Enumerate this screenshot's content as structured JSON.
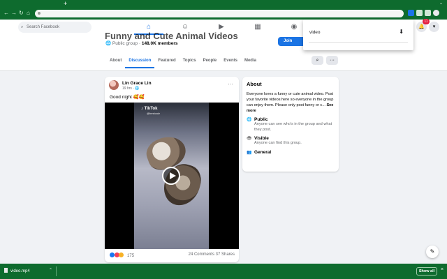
{
  "browser": {
    "newtab_label": "+",
    "tabs_chevron": "⌄",
    "nav": {
      "back": "←",
      "forward": "→",
      "reload": "↻",
      "home": "⌂"
    },
    "toolbar_bg": "#0e6b2e"
  },
  "facebook": {
    "search_placeholder": "Search Facebook",
    "search_icon": "⌕",
    "nav_icons": {
      "home": "⌂",
      "friends": "☺",
      "watch": "▶",
      "marketplace": "▦",
      "groups": "◉"
    },
    "notifications_count": "11",
    "accent": "#1b74e4"
  },
  "group": {
    "title": "Funny and Cute Animal Videos",
    "privacy": "Public group",
    "separator": " · ",
    "members": "148.0K members",
    "join_label": "Join",
    "tabs": [
      "About",
      "Discussion",
      "Featured",
      "Topics",
      "People",
      "Events",
      "Media"
    ],
    "active_tab": "Discussion",
    "search_icon": "⌕",
    "more_icon": "···"
  },
  "post": {
    "author": "Lin Grace Lin",
    "time": "19 hrs",
    "text": "Good night 🥰🥰",
    "more_icon": "···",
    "tiktok_label": "♪ TikTok",
    "tiktok_handle": "@bestcatz",
    "reaction_count": "175",
    "comments": "24 Comments",
    "shares": "37 Shares"
  },
  "about": {
    "title": "About",
    "description": "Everyone loves a funny or cute animal video. Post your favorite videos here so everyone in the group can enjoy them. Please only post funny or c...",
    "see_more": "See more",
    "public_label": "Public",
    "public_desc": "Anyone can see who's in the group and what they post.",
    "visible_label": "Visible",
    "visible_desc": "Anyone can find this group.",
    "general_label": "General"
  },
  "downloads_popup": {
    "filename": "video",
    "download_icon": "⬇"
  },
  "shelf": {
    "file": "video.mp4",
    "show_all": "Show all",
    "close": "×"
  }
}
